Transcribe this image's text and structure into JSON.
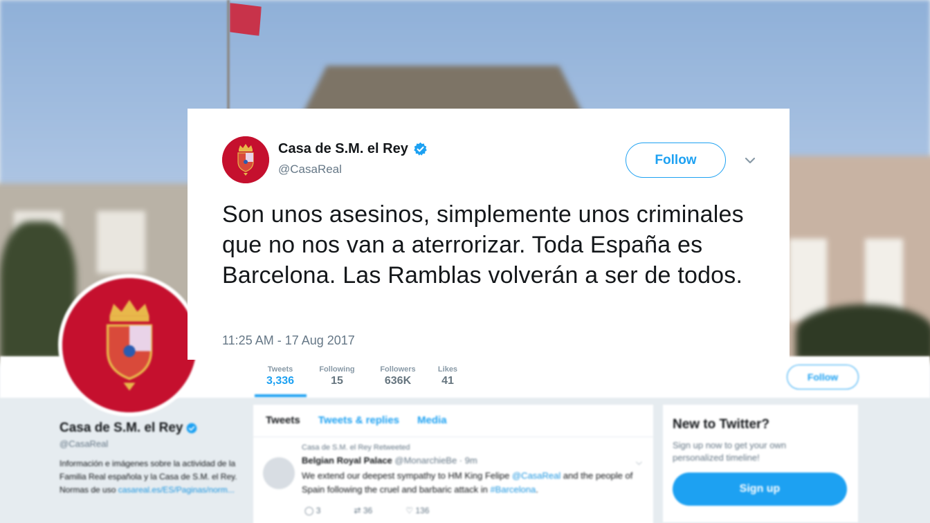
{
  "tweet": {
    "display_name": "Casa de S.M. el Rey",
    "handle": "@CasaReal",
    "follow_label": "Follow",
    "text": "Son unos asesinos, simplemente unos criminales que no nos van a aterrorizar. Toda España es Barcelona. Las Ramblas volverán a ser de todos.",
    "timestamp": "11:25 AM - 17 Aug 2017"
  },
  "background_profile": {
    "stats": [
      {
        "label": "Tweets",
        "value": "3,336"
      },
      {
        "label": "Following",
        "value": "15"
      },
      {
        "label": "Followers",
        "value": "636K"
      },
      {
        "label": "Likes",
        "value": "41"
      }
    ],
    "follow_label": "Follow",
    "name": "Casa de S.M. el Rey",
    "handle": "@CasaReal",
    "bio": "Información e imágenes sobre la actividad de la Familia Real española y la Casa de S.M. el Rey. Normas de uso",
    "bio_link": "casareal.es/ES/Paginas/norm...",
    "timeline": {
      "tabs": [
        "Tweets",
        "Tweets & replies",
        "Media"
      ],
      "retweet_context": "Casa de S.M. el Rey Retweeted",
      "author_name": "Belgian Royal Palace",
      "author_handle": "@MonarchieBe · 9m",
      "text_before": "We extend our deepest sympathy to HM King Felipe ",
      "mention": "@CasaReal",
      "text_middle": " and the people of Spain following the cruel and barbaric attack in ",
      "hashtag": "#Barcelona",
      "text_after": ".",
      "reply_count": "3",
      "retweet_count": "36",
      "like_count": "136"
    },
    "sidebar": {
      "title": "New to Twitter?",
      "text": "Sign up now to get your own personalized timeline!",
      "signup_label": "Sign up"
    }
  },
  "colors": {
    "twitter_blue": "#1da1f2",
    "royal_red": "#c5102e",
    "text_primary": "#14171a",
    "text_secondary": "#657786"
  },
  "icons": [
    "verified-badge-icon",
    "chevron-down-icon",
    "royal-crest-icon",
    "reply-icon",
    "retweet-icon",
    "like-icon"
  ]
}
